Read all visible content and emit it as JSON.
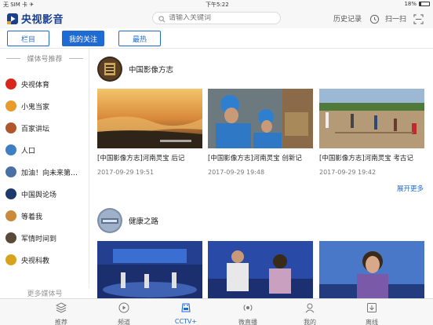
{
  "status_bar": {
    "carrier": "无 SIM 卡 ✈",
    "time": "下午5:22",
    "battery": "18%",
    "battery_level": 0.18
  },
  "header": {
    "logo_text": "央视影音",
    "search_placeholder": "请输入关键词",
    "history_label": "历史记录",
    "scan_label": "扫一扫"
  },
  "tabs": [
    {
      "label": "栏目",
      "active": false
    },
    {
      "label": "我的关注",
      "active": true
    },
    {
      "label": "最热",
      "active": false
    }
  ],
  "sidebar": {
    "title": "媒体号推荐",
    "items": [
      {
        "label": "央视体育",
        "color": "#d9251c"
      },
      {
        "label": "小鬼当家",
        "color": "#e89a2c"
      },
      {
        "label": "百家讲坛",
        "color": "#b0562c"
      },
      {
        "label": "人口",
        "color": "#3e7fc1"
      },
      {
        "label": "加油！向未来第…",
        "color": "#4a6fa5"
      },
      {
        "label": "中国舆论场",
        "color": "#1e3a6b"
      },
      {
        "label": "等着我",
        "color": "#c98a3a"
      },
      {
        "label": "军情时间到",
        "color": "#5a4a3a"
      },
      {
        "label": "央视科教",
        "color": "#d9a21c"
      }
    ],
    "more_label": "更多媒体号"
  },
  "sections": [
    {
      "name": "中国影像方志",
      "videos": [
        {
          "title": "[中国影像方志]河南灵宝 后记",
          "date": "2017-09-29  19:51"
        },
        {
          "title": "[中国影像方志]河南灵宝 创新记",
          "date": "2017-09-29  19:48"
        },
        {
          "title": "[中国影像方志]河南灵宝 考古记",
          "date": "2017-09-29  19:42"
        }
      ],
      "expand_label": "展开更多"
    },
    {
      "name": "健康之路",
      "videos": [
        {
          "title": "",
          "date": ""
        },
        {
          "title": "",
          "date": ""
        },
        {
          "title": "",
          "date": ""
        }
      ]
    }
  ],
  "bottom_nav": [
    {
      "label": "推荐",
      "icon": "stack-icon",
      "active": false
    },
    {
      "label": "频道",
      "icon": "play-circle-icon",
      "active": false
    },
    {
      "label": "CCTV+",
      "icon": "cctv-plus-icon",
      "active": true
    },
    {
      "label": "微直播",
      "icon": "live-icon",
      "active": false
    },
    {
      "label": "我的",
      "icon": "user-icon",
      "active": false
    },
    {
      "label": "离线",
      "icon": "download-icon",
      "active": false
    }
  ]
}
